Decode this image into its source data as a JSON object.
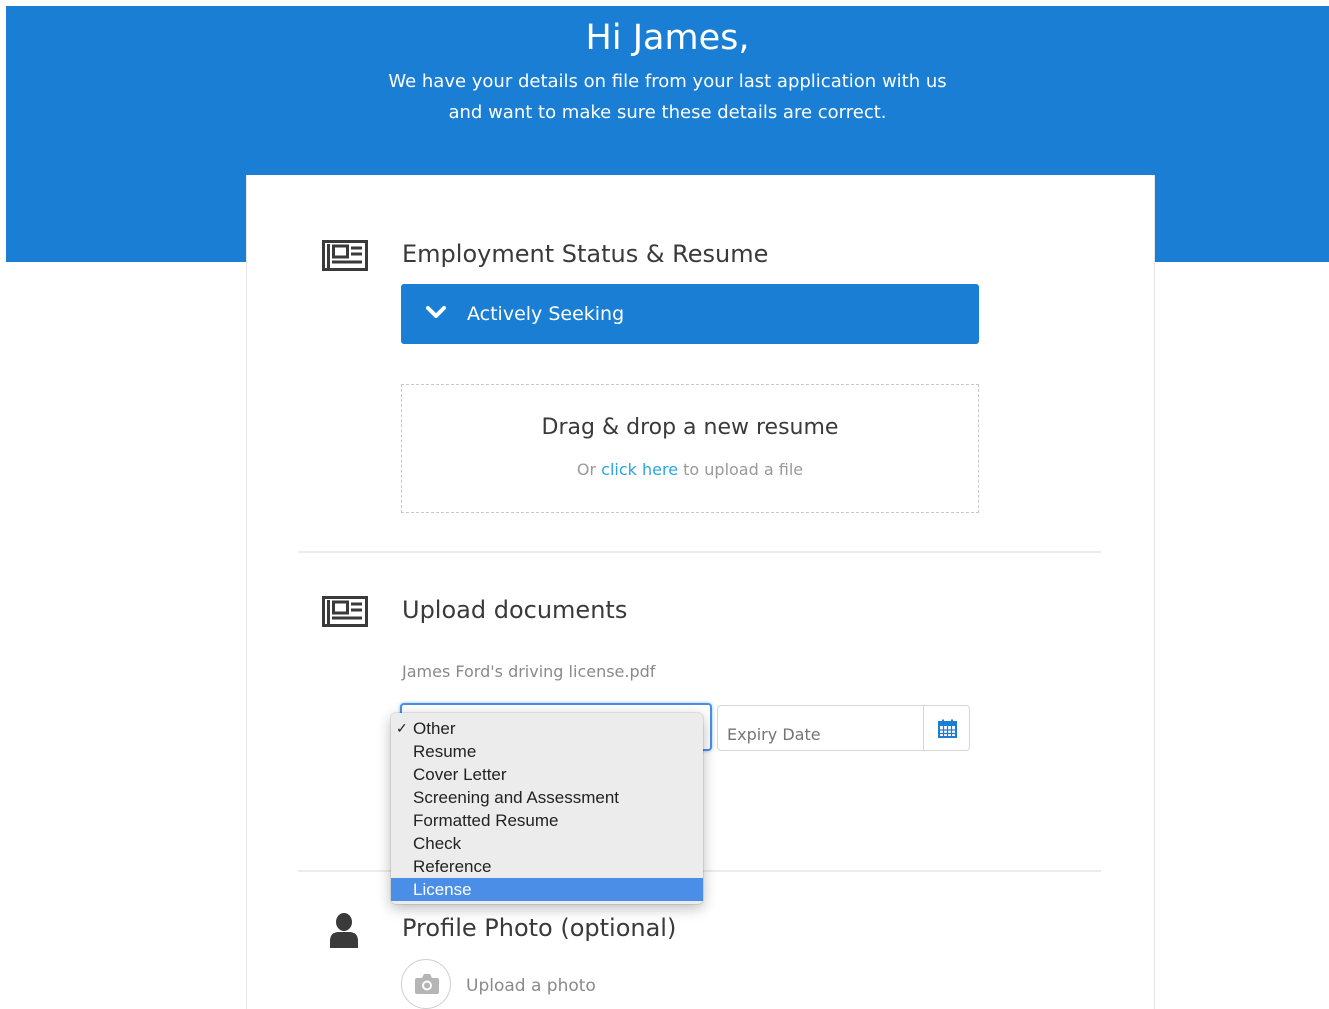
{
  "header": {
    "greeting": "Hi James,",
    "intro_line1": "We have your details on file from your last application with us",
    "intro_line2": "and want to make sure these details are correct."
  },
  "employment": {
    "title": "Employment Status & Resume",
    "status_label": "Actively Seeking",
    "status_icon": "chevron-down-icon",
    "section_icon": "newspaper-icon"
  },
  "dropzone": {
    "title": "Drag & drop a new resume",
    "prefix": "Or ",
    "link": "click here",
    "suffix": " to upload a file"
  },
  "documents": {
    "title": "Upload documents",
    "section_icon": "newspaper-icon",
    "filename": "James Ford's driving license.pdf",
    "expiry_placeholder": "Expiry Date",
    "calendar_icon": "calendar-icon",
    "type_options": [
      {
        "label": "Other",
        "checked": true
      },
      {
        "label": "Resume"
      },
      {
        "label": "Cover Letter"
      },
      {
        "label": "Screening and Assessment"
      },
      {
        "label": "Formatted Resume"
      },
      {
        "label": "Check"
      },
      {
        "label": "Reference"
      },
      {
        "label": "License",
        "highlighted": true
      }
    ],
    "check_mark": "✓"
  },
  "profile_photo": {
    "title": "Profile Photo (optional)",
    "section_icon": "user-icon",
    "upload_label": "Upload a photo",
    "upload_icon": "camera-icon"
  },
  "colors": {
    "brand_blue": "#1a7fd4",
    "link": "#2aa5e0",
    "highlight": "#4a8ee8"
  }
}
